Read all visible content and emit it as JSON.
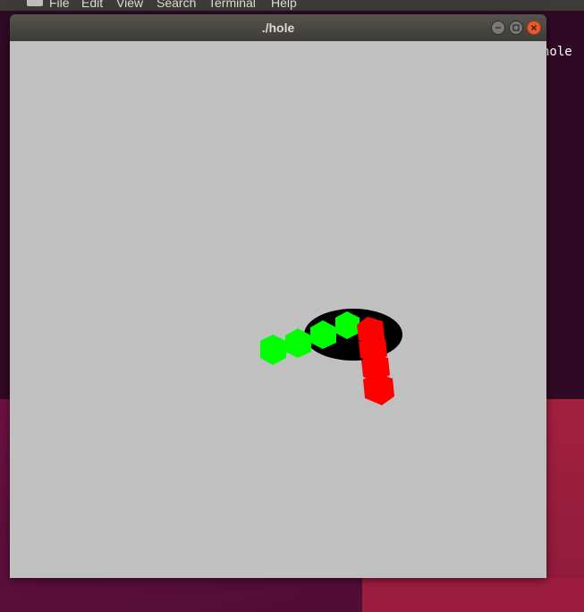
{
  "terminal": {
    "menu": [
      "File",
      "Edit",
      "View",
      "Search",
      "Terminal",
      "Help"
    ],
    "visible_text": "hole",
    "icon": "terminal-app-icon"
  },
  "window": {
    "title": "./hole",
    "buttons": {
      "minimize": "minimize-icon",
      "maximize": "maximize-icon",
      "close": "close-icon"
    }
  },
  "scene": {
    "background_color": "#c0c0c0",
    "hole_color": "#000000",
    "green_chain_color": "#00ff00",
    "red_chain_color": "#ff0000",
    "green_cube_count": 4,
    "red_cube_count": 4
  }
}
